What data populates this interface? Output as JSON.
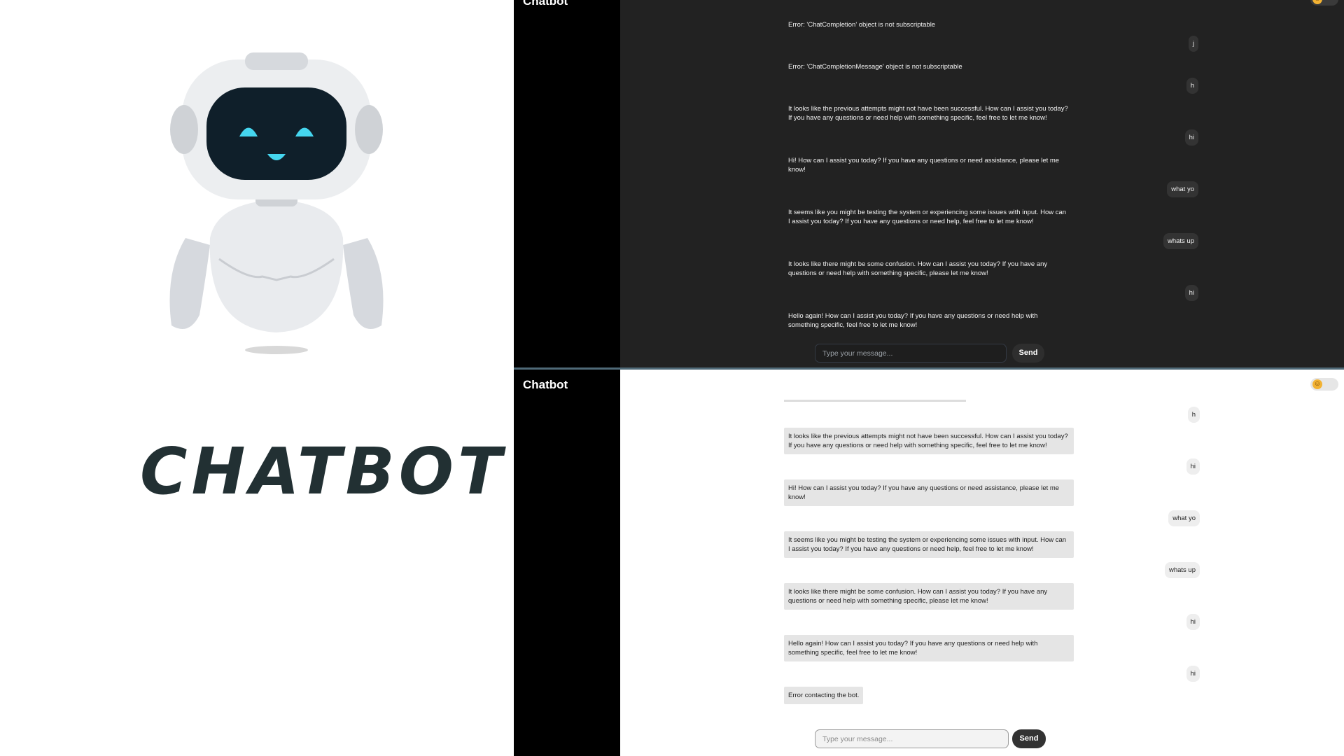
{
  "promo": {
    "brand_text": "CHATBOT"
  },
  "dark_view": {
    "sidebar_title": "Chatbot",
    "theme_toggle_icon": "emoji-icon",
    "messages": [
      {
        "role": "bot",
        "text": "Error: 'ChatCompletion' object is not subscriptable"
      },
      {
        "role": "user",
        "text": "j"
      },
      {
        "role": "bot",
        "text": "Error: 'ChatCompletionMessage' object is not subscriptable"
      },
      {
        "role": "user",
        "text": "h"
      },
      {
        "role": "bot",
        "text": "It looks like the previous attempts might not have been successful. How can I assist you today? If you have any questions or need help with something specific, feel free to let me know!"
      },
      {
        "role": "user",
        "text": "hi"
      },
      {
        "role": "bot",
        "text": "Hi! How can I assist you today? If you have any questions or need assistance, please let me know!"
      },
      {
        "role": "user",
        "text": "what yo"
      },
      {
        "role": "bot",
        "text": "It seems like you might be testing the system or experiencing some issues with input. How can I assist you today? If you have any questions or need help, feel free to let me know!"
      },
      {
        "role": "user",
        "text": "whats up"
      },
      {
        "role": "bot",
        "text": "It looks like there might be some confusion. How can I assist you today? If you have any questions or need help with something specific, please let me know!"
      },
      {
        "role": "user",
        "text": "hi"
      },
      {
        "role": "bot",
        "text": "Hello again! How can I assist you today? If you have any questions or need help with something specific, feel free to let me know!"
      }
    ],
    "input_placeholder": "Type your message...",
    "send_label": "Send"
  },
  "light_view": {
    "sidebar_title": "Chatbot",
    "theme_toggle_icon": "emoji-icon",
    "messages": [
      {
        "role": "user",
        "text": "h"
      },
      {
        "role": "bot",
        "text": "It looks like the previous attempts might not have been successful. How can I assist you today? If you have any questions or need help with something specific, feel free to let me know!"
      },
      {
        "role": "user",
        "text": "hi"
      },
      {
        "role": "bot",
        "text": "Hi! How can I assist you today? If you have any questions or need assistance, please let me know!"
      },
      {
        "role": "user",
        "text": "what yo"
      },
      {
        "role": "bot",
        "text": "It seems like you might be testing the system or experiencing some issues with input. How can I assist you today? If you have any questions or need help, feel free to let me know!"
      },
      {
        "role": "user",
        "text": "whats up"
      },
      {
        "role": "bot",
        "text": "It looks like there might be some confusion. How can I assist you today? If you have any questions or need help with something specific, please let me know!"
      },
      {
        "role": "user",
        "text": "hi"
      },
      {
        "role": "bot",
        "text": "Hello again! How can I assist you today? If you have any questions or need help with something specific, feel free to let me know!"
      },
      {
        "role": "user",
        "text": "hi"
      },
      {
        "role": "bot",
        "text": "Error contacting the bot."
      }
    ],
    "input_placeholder": "Type your message...",
    "send_label": "Send"
  }
}
